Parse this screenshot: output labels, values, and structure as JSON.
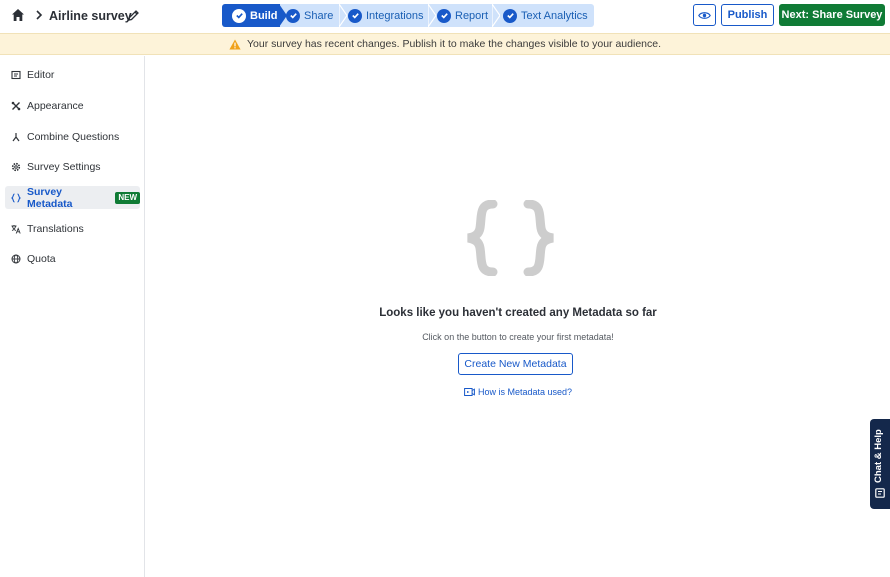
{
  "header": {
    "survey_title": "Airline survey",
    "steps": [
      {
        "label": "Build",
        "active": true
      },
      {
        "label": "Share",
        "active": false
      },
      {
        "label": "Integrations",
        "active": false
      },
      {
        "label": "Report",
        "active": false
      },
      {
        "label": "Text Analytics",
        "active": false
      }
    ],
    "publish_label": "Publish",
    "next_label": "Next: Share Survey"
  },
  "banner": {
    "message": "Your survey has recent changes. Publish it to make the changes visible to your audience."
  },
  "sidebar": {
    "items": [
      {
        "label": "Editor",
        "icon": "editor-icon"
      },
      {
        "label": "Appearance",
        "icon": "appearance-icon"
      },
      {
        "label": "Combine Questions",
        "icon": "combine-icon"
      },
      {
        "label": "Survey Settings",
        "icon": "gear-icon"
      },
      {
        "label": "Survey Metadata",
        "icon": "braces-icon",
        "active": true,
        "badge": "NEW"
      },
      {
        "label": "Translations",
        "icon": "translate-icon"
      },
      {
        "label": "Quota",
        "icon": "globe-icon"
      }
    ]
  },
  "main": {
    "empty_title": "Looks like you haven't created any Metadata so far",
    "empty_subtitle": "Click on the button to create your first metadata!",
    "create_label": "Create New Metadata",
    "help_link": "How is Metadata used?"
  },
  "chat": {
    "label": "Chat & Help"
  },
  "colors": {
    "primary": "#1859c9",
    "success": "#0f7b35",
    "warning_bg": "#fdf3d9",
    "warning_icon": "#f0a21a",
    "chat_bg": "#14284b"
  }
}
